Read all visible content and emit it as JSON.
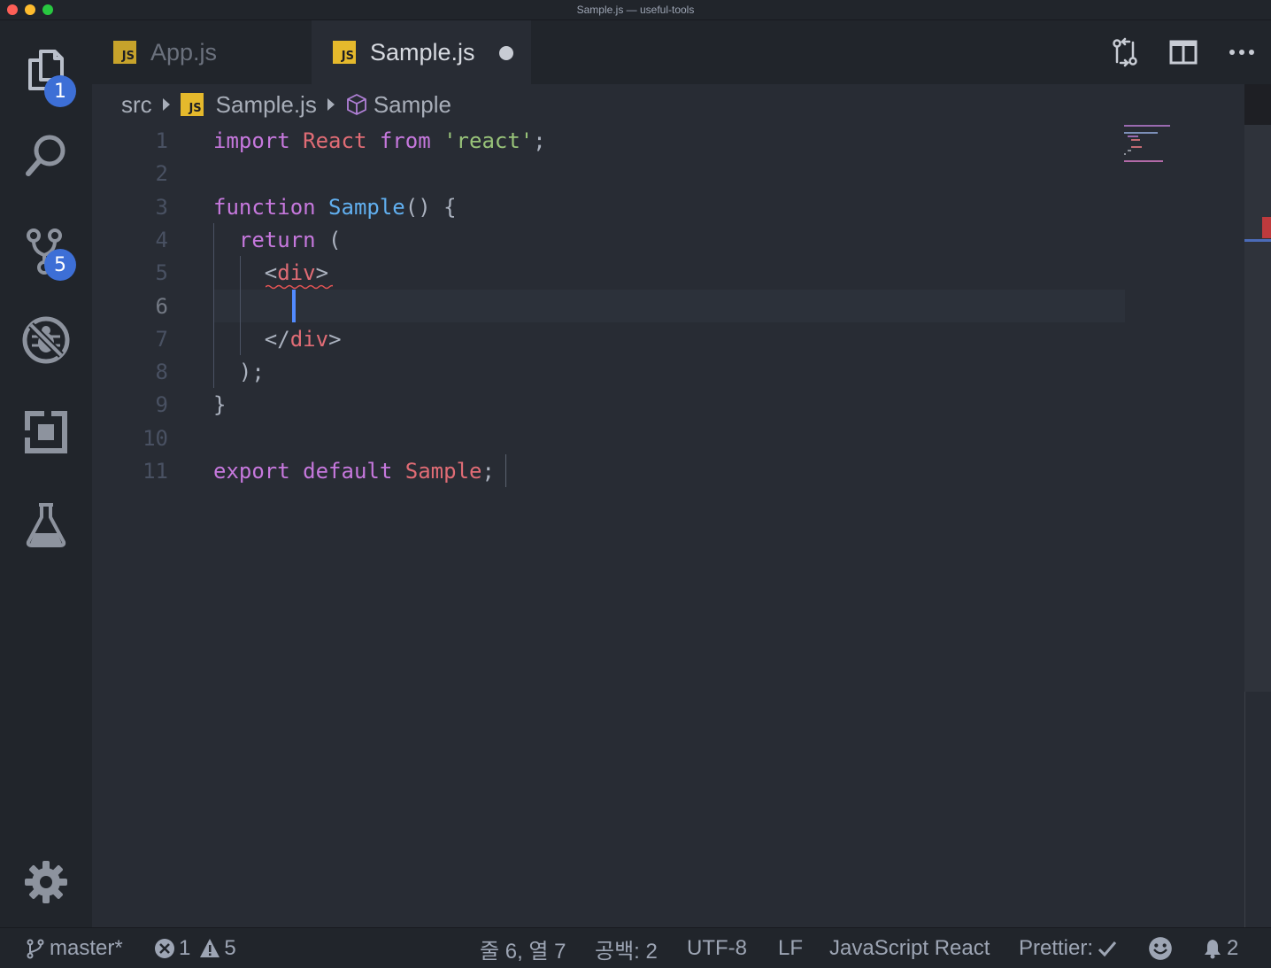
{
  "window": {
    "title": "Sample.js — useful-tools"
  },
  "activity_bar": {
    "explorer_badge": "1",
    "scm_badge": "5"
  },
  "tabs": [
    {
      "label": "App.js",
      "icon": "JS",
      "active": false
    },
    {
      "label": "Sample.js",
      "icon": "JS",
      "active": true,
      "dirty": true
    }
  ],
  "breadcrumbs": {
    "folder": "src",
    "file": "Sample.js",
    "file_icon": "JS",
    "symbol": "Sample"
  },
  "editor": {
    "line_numbers": [
      "1",
      "2",
      "3",
      "4",
      "5",
      "6",
      "7",
      "8",
      "9",
      "10",
      "11"
    ],
    "active_line": 6,
    "lines": [
      [
        {
          "t": "import",
          "c": "kw"
        },
        {
          "t": " ",
          "c": "pun"
        },
        {
          "t": "React",
          "c": "var"
        },
        {
          "t": " ",
          "c": "pun"
        },
        {
          "t": "from",
          "c": "kw"
        },
        {
          "t": " ",
          "c": "pun"
        },
        {
          "t": "'react'",
          "c": "str"
        },
        {
          "t": ";",
          "c": "pun"
        }
      ],
      [],
      [
        {
          "t": "function",
          "c": "kw"
        },
        {
          "t": " ",
          "c": "pun"
        },
        {
          "t": "Sample",
          "c": "fn"
        },
        {
          "t": "() {",
          "c": "pun"
        }
      ],
      [
        {
          "t": "  ",
          "c": "pun"
        },
        {
          "t": "return",
          "c": "kw"
        },
        {
          "t": " (",
          "c": "pun"
        }
      ],
      [
        {
          "t": "    <",
          "c": "pun"
        },
        {
          "t": "div",
          "c": "tag"
        },
        {
          "t": ">",
          "c": "pun"
        }
      ],
      [],
      [
        {
          "t": "    </",
          "c": "pun"
        },
        {
          "t": "div",
          "c": "tag"
        },
        {
          "t": ">",
          "c": "pun"
        }
      ],
      [
        {
          "t": "  );",
          "c": "pun"
        }
      ],
      [
        {
          "t": "}",
          "c": "pun"
        }
      ],
      [],
      [
        {
          "t": "export",
          "c": "kw"
        },
        {
          "t": " ",
          "c": "pun"
        },
        {
          "t": "default",
          "c": "kw"
        },
        {
          "t": " ",
          "c": "pun"
        },
        {
          "t": "Sample",
          "c": "var"
        },
        {
          "t": ";",
          "c": "pun"
        }
      ]
    ]
  },
  "colors": {
    "keyword": "#c678dd",
    "function": "#61afef",
    "string": "#98c379",
    "variable": "#e06c75",
    "badge": "#3d6fd6",
    "js_icon": "#e5b92c"
  },
  "status_bar": {
    "branch": "master*",
    "errors": "1",
    "warnings": "5",
    "position": "줄 6, 열 7",
    "indent": "공백: 2",
    "encoding": "UTF-8",
    "eol": "LF",
    "language": "JavaScript React",
    "formatter": "Prettier:",
    "notifications": "2"
  }
}
